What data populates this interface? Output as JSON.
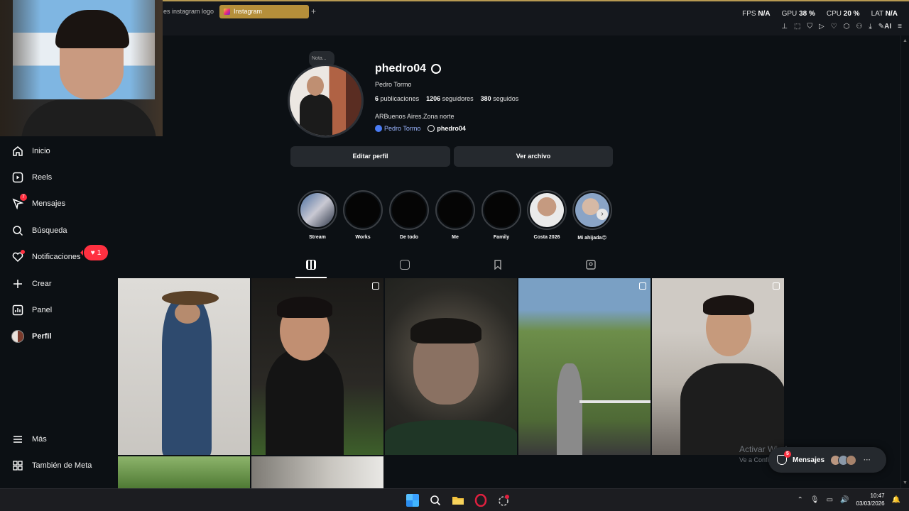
{
  "browser": {
    "tabs": [
      {
        "label": "es instagram logo",
        "active": false
      },
      {
        "label": "Instagram",
        "active": true
      }
    ],
    "new_tab_symbol": "+",
    "perf": {
      "fps_label": "FPS",
      "fps_value": "N/A",
      "gpu_label": "GPU",
      "gpu_value": "38 %",
      "cpu_label": "CPU",
      "cpu_value": "20 %",
      "lat_label": "LAT",
      "lat_value": "N/A"
    },
    "ai_label": "AI"
  },
  "sidebar": {
    "items": [
      {
        "label": "Inicio",
        "icon": "home-icon"
      },
      {
        "label": "Reels",
        "icon": "reels-icon"
      },
      {
        "label": "Mensajes",
        "icon": "messenger-icon",
        "badge": "7"
      },
      {
        "label": "Búsqueda",
        "icon": "search-icon"
      },
      {
        "label": "Notificaciones",
        "icon": "heart-icon"
      },
      {
        "label": "Crear",
        "icon": "plus-icon"
      },
      {
        "label": "Panel",
        "icon": "chart-icon"
      },
      {
        "label": "Perfil",
        "icon": "avatar-icon"
      },
      {
        "label": "Más",
        "icon": "menu-icon"
      },
      {
        "label": "También de Meta",
        "icon": "meta-grid-icon"
      }
    ],
    "notification_count": "1"
  },
  "profile": {
    "note_label": "Nota...",
    "username": "phedro04",
    "full_name": "Pedro Tormo",
    "stats": {
      "posts_count": "6",
      "posts_label": "publicaciones",
      "followers_count": "1206",
      "followers_label": "seguidores",
      "following_count": "380",
      "following_label": "seguidos"
    },
    "bio": "ARBuenos Aires.Zona norte",
    "facebook_link": "Pedro Tormo",
    "threads_link": "phedro04",
    "edit_button": "Editar perfil",
    "archive_button": "Ver archivo"
  },
  "highlights": [
    {
      "label": "Stream"
    },
    {
      "label": "Works"
    },
    {
      "label": "De todo"
    },
    {
      "label": "Me"
    },
    {
      "label": "Family"
    },
    {
      "label": "Costa 2026"
    },
    {
      "label": "Mi ahijada😍"
    }
  ],
  "profile_tabs": [
    "posts-grid",
    "reels",
    "saved",
    "tagged"
  ],
  "watermark": {
    "title": "Activar Windows",
    "subtitle": "Ve a Configuración para activar"
  },
  "messages_pill": {
    "label": "Mensajes",
    "badge": "5"
  },
  "taskbar": {
    "time": "10:47",
    "date": "03/03/2026"
  },
  "colors": {
    "accent_badge": "#ff3040",
    "active_tab": "#b58f3a",
    "page_background": "#0c1014",
    "button_background": "#25292e"
  }
}
